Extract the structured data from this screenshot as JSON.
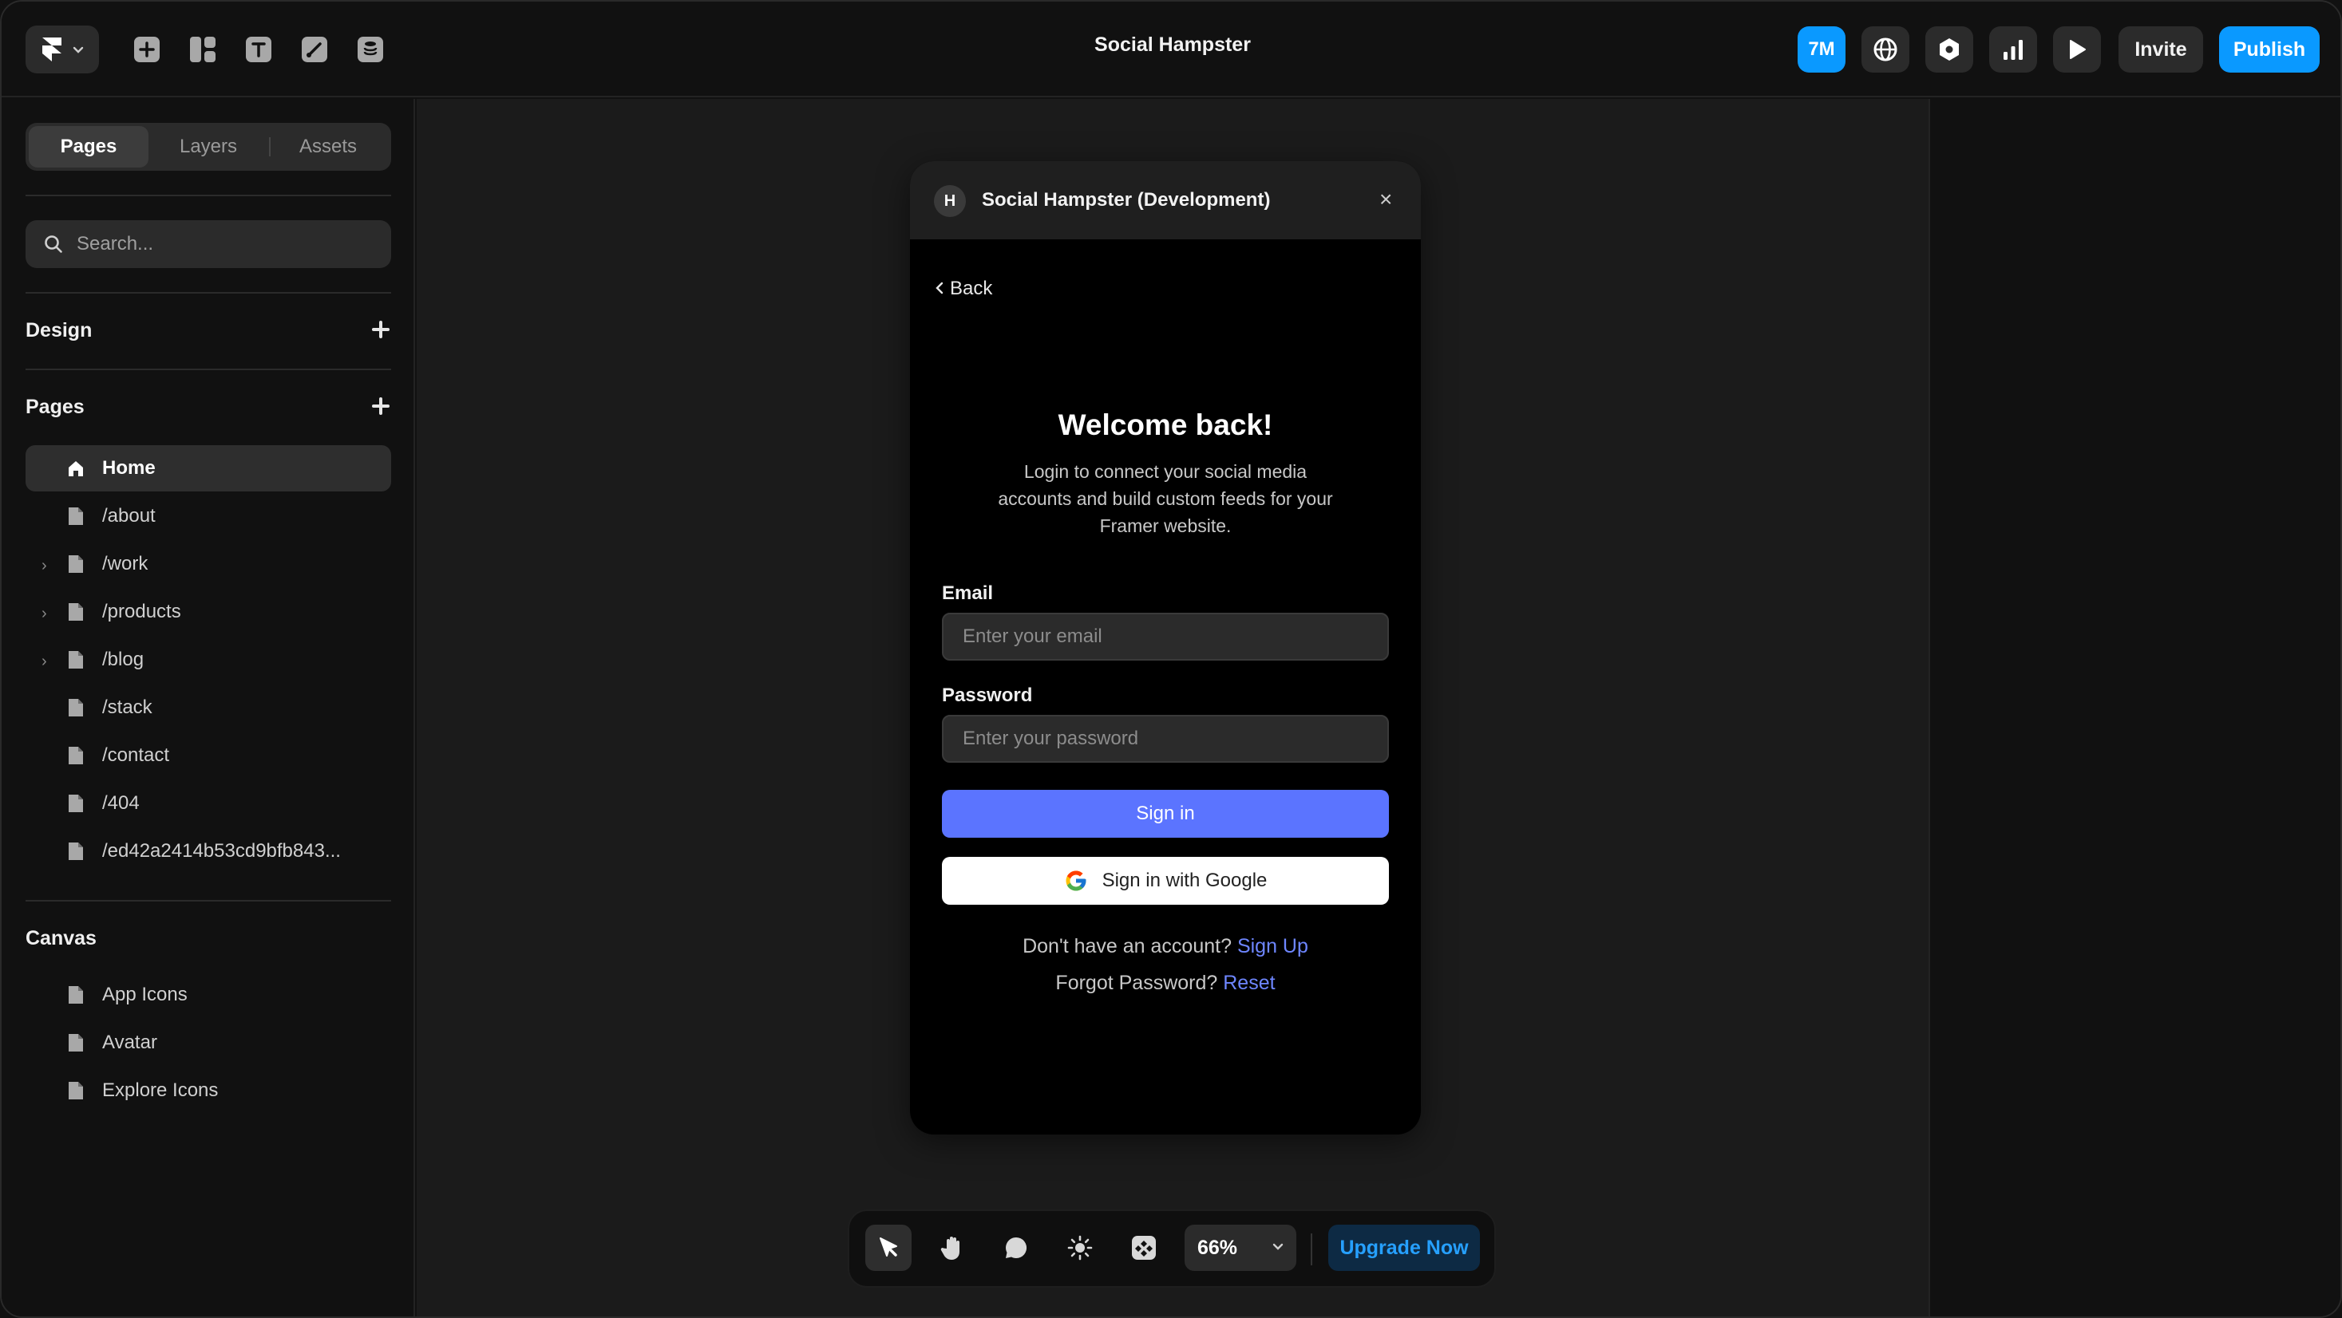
{
  "app": {
    "title": "Social Hampster"
  },
  "topbar": {
    "badge_label": "7M",
    "invite_label": "Invite",
    "publish_label": "Publish",
    "colors": {
      "accent": "#0a99ff"
    }
  },
  "sidebar": {
    "tabs": [
      {
        "label": "Pages",
        "active": true
      },
      {
        "label": "Layers",
        "active": false
      },
      {
        "label": "Assets",
        "active": false
      }
    ],
    "search": {
      "placeholder": "Search..."
    },
    "design_title": "Design",
    "pages_title": "Pages",
    "pages": [
      {
        "label": "Home",
        "icon": "home-icon",
        "active": true,
        "expandable": false
      },
      {
        "label": "/about",
        "icon": "page-icon",
        "active": false,
        "expandable": false
      },
      {
        "label": "/work",
        "icon": "page-icon",
        "active": false,
        "expandable": true
      },
      {
        "label": "/products",
        "icon": "page-icon",
        "active": false,
        "expandable": true
      },
      {
        "label": "/blog",
        "icon": "page-icon",
        "active": false,
        "expandable": true
      },
      {
        "label": "/stack",
        "icon": "page-icon",
        "active": false,
        "expandable": false
      },
      {
        "label": "/contact",
        "icon": "page-icon",
        "active": false,
        "expandable": false
      },
      {
        "label": "/404",
        "icon": "page-icon",
        "active": false,
        "expandable": false
      },
      {
        "label": "/ed42a2414b53cd9bfb843...",
        "icon": "page-icon",
        "active": false,
        "expandable": false
      }
    ],
    "canvas_title": "Canvas",
    "canvas_pages": [
      {
        "label": "App Icons",
        "icon": "page-icon"
      },
      {
        "label": "Avatar",
        "icon": "page-icon"
      },
      {
        "label": "Explore Icons",
        "icon": "page-icon"
      }
    ]
  },
  "plugin": {
    "logo_letter": "H",
    "title": "Social Hampster (Development)",
    "close_glyph": "×",
    "back_label": "Back",
    "heading": "Welcome back!",
    "subtitle": "Login to connect your social media accounts and build custom feeds for your Framer website.",
    "email_label": "Email",
    "email_placeholder": "Enter your email",
    "password_label": "Password",
    "password_placeholder": "Enter your password",
    "signin_label": "Sign in",
    "google_label": "Sign in with Google",
    "no_account_text": "Don't have an account?",
    "signup_link": "Sign Up",
    "forgot_text": "Forgot Password?",
    "reset_link": "Reset",
    "colors": {
      "primary": "#5b74ff",
      "link": "#6e86ff"
    }
  },
  "bottombar": {
    "tools": [
      "select-icon",
      "hand-icon",
      "comment-icon",
      "brightness-icon",
      "component-icon"
    ],
    "zoom_value": "66%",
    "upgrade_label": "Upgrade Now"
  }
}
